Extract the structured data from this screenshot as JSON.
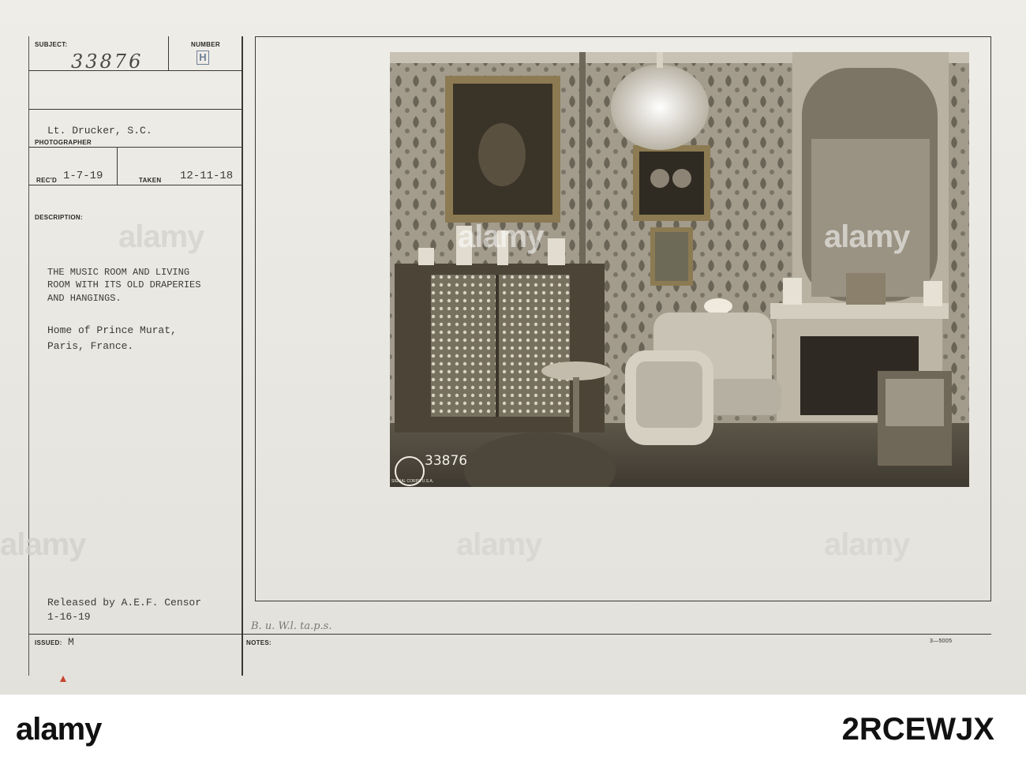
{
  "form": {
    "subject_label": "SUBJECT:",
    "subject_value": "33876",
    "number_label": "NUMBER",
    "number_value": "H",
    "photographer_value": "Lt. Drucker, S.C.",
    "photographer_label": "PHOTOGRAPHER",
    "recd_label": "REC'D",
    "recd_value": "1-7-19",
    "taken_label": "TAKEN",
    "taken_value": "12-11-18",
    "description_label": "DESCRIPTION:",
    "description_lines": [
      "THE MUSIC ROOM AND LIVING",
      "ROOM WITH ITS OLD DRAPERIES",
      "AND HANGINGS."
    ],
    "location_lines": [
      "Home of Prince Murat,",
      "Paris, France."
    ],
    "release_line1": "Released by A.E.F. Censor",
    "release_line2": "1-16-19",
    "issued_label": "ISSUED:",
    "issued_value": "M",
    "notes_label": "NOTES:",
    "notes_handwriting": "B. u. W.l. ta.p.s.",
    "form_code": "3—5005"
  },
  "photo": {
    "stamp_number": "33876",
    "stamp_text": "SIGNAL CORPS U.S.A."
  },
  "watermark": {
    "text": "alamy",
    "image_code": "2RCEWJX"
  }
}
